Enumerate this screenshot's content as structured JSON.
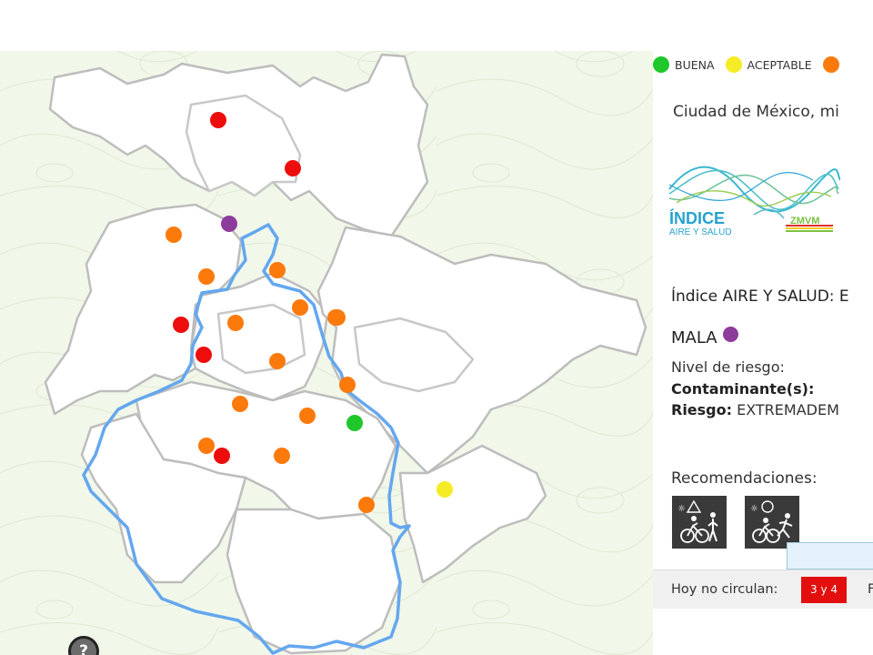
{
  "map": {
    "help_label": "?",
    "colors": {
      "background": "#f1f7e9",
      "region_fill": "#ffffff",
      "region_stroke": "#bdbdbd",
      "boundary": "#64a7ef"
    },
    "stations": [
      {
        "level": "mala"
      },
      {
        "level": "muy_mala"
      },
      {
        "level": "muy_mala"
      },
      {
        "level": "mala"
      },
      {
        "level": "mala"
      },
      {
        "level": "mala"
      },
      {
        "level": "mala"
      },
      {
        "level": "mala"
      },
      {
        "level": "muy_mala"
      },
      {
        "level": "mala"
      },
      {
        "level": "muy_mala"
      },
      {
        "level": "mala"
      },
      {
        "level": "mala"
      },
      {
        "level": "mala"
      },
      {
        "level": "mala"
      },
      {
        "level": "buena"
      },
      {
        "level": "mala"
      },
      {
        "level": "muy_mala"
      },
      {
        "level": "mala"
      },
      {
        "level": "aceptable"
      },
      {
        "level": "mala"
      },
      {
        "level": "extremadamente_mala"
      }
    ]
  },
  "level_colors": {
    "buena": "#1fc72a",
    "aceptable": "#f6ec26",
    "mala": "#fc7a0b",
    "muy_mala": "#ee0d0d",
    "extremadamente_mala": "#8e3c9c"
  },
  "legend": [
    {
      "label": "BUENA",
      "color": "#1fc72a"
    },
    {
      "label": "ACEPTABLE",
      "color": "#f6ec26"
    },
    {
      "label": "",
      "color": "#fc7a0b"
    }
  ],
  "panel": {
    "location": "Ciudad de México, mi",
    "logo": {
      "word": "ÍNDICE",
      "sub": "AIRE Y SALUD",
      "badge": "ZMVM"
    },
    "index_line": "Índice AIRE Y SALUD: E",
    "quality": "MALA",
    "risk_label": "Nivel de riesgo:",
    "pollutant_label": "Contaminante(s):",
    "risk_prefix": "Riesgo:",
    "risk_value": " EXTREMADEM",
    "recommendations_title": "Recomendaciones:",
    "hoy_no_circulan_label": "Hoy no circulan:",
    "hoy_no_circulan_value": "3 y 4",
    "hoy_next": "F"
  }
}
